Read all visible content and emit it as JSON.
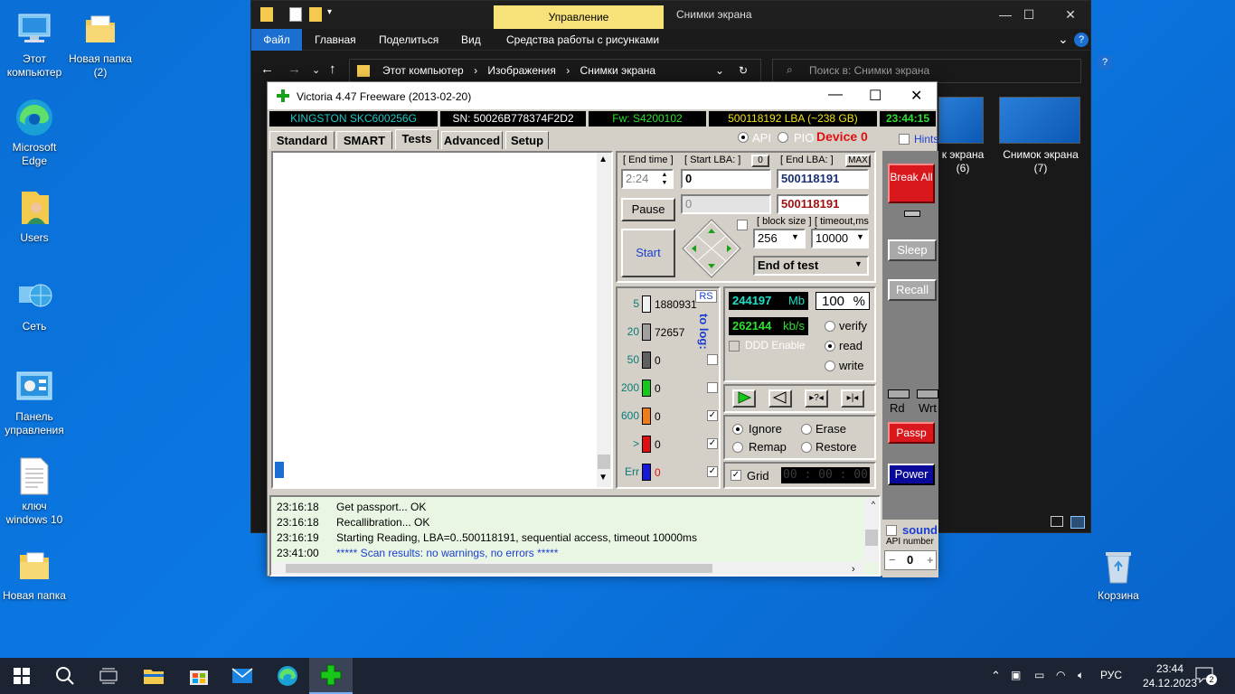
{
  "desktop": {
    "icons": [
      {
        "label": "Этот компьютер"
      },
      {
        "label": "Новая папка (2)"
      },
      {
        "label": "Microsoft Edge"
      },
      {
        "label": "Users"
      },
      {
        "label": "Сеть"
      },
      {
        "label": "Панель управления"
      },
      {
        "label": "ключ windows 10"
      },
      {
        "label": "Новая папка"
      },
      {
        "label": "Корзина"
      }
    ]
  },
  "explorer": {
    "context_tab": "Управление",
    "window_title": "Снимки экрана",
    "ribbon": {
      "file": "Файл",
      "home": "Главная",
      "share": "Поделиться",
      "view": "Вид",
      "picture_tools": "Средства работы с рисунками"
    },
    "breadcrumb": [
      "Этот компьютер",
      "Изображения",
      "Снимки экрана"
    ],
    "search_placeholder": "Поиск в: Снимки экрана",
    "thumbs": [
      {
        "label_line1": "к экрана",
        "label_line2": "(6)"
      },
      {
        "label_line1": "Снимок экрана",
        "label_line2": "(7)"
      }
    ]
  },
  "victoria": {
    "title": "Victoria 4.47  Freeware (2013-02-20)",
    "info": {
      "model": "KINGSTON SKC600256G",
      "serial": "SN: 50026B778374F2D2",
      "firmware": "Fw: S4200102",
      "capacity": "500118192 LBA (~238 GB)",
      "clock": "23:44:15"
    },
    "tabs": [
      "Standard",
      "SMART",
      "Tests",
      "Advanced",
      "Setup"
    ],
    "mode": {
      "api": "API",
      "pio": "PIO",
      "device": "Device 0",
      "hints": "Hints"
    },
    "test": {
      "end_time_label": "[ End time ]",
      "end_time": "2:24",
      "start_lba_label": "[ Start LBA: ]",
      "start_lba_zero_btn": "0",
      "start_lba": "0",
      "end_lba_label": "[ End LBA: ]",
      "end_lba_max_btn": "MAX",
      "end_lba": "500118191",
      "current_lba": "0",
      "current_end_lba": "500118191",
      "pause": "Pause",
      "start": "Start",
      "block_size_label": "[ block size ]",
      "block_size": "256",
      "timeout_label": "[ timeout,ms ]",
      "timeout": "10000",
      "end_action": "End of test"
    },
    "blocks": {
      "rs": "RS",
      "to_log": "to log:",
      "rows": [
        {
          "label": "5",
          "count": "1880931",
          "color": "#f0f0f0",
          "logged": false
        },
        {
          "label": "20",
          "count": "72657",
          "color": "#a0a0a0",
          "logged": false
        },
        {
          "label": "50",
          "count": "0",
          "color": "#606060",
          "logged": false
        },
        {
          "label": "200",
          "count": "0",
          "color": "#18c818",
          "logged": false
        },
        {
          "label": "600",
          "count": "0",
          "color": "#f07c18",
          "logged": true
        },
        {
          "label": ">",
          "count": "0",
          "color": "#e01010",
          "logged": true
        },
        {
          "label": "Err",
          "count": "0",
          "color": "#1818d8",
          "logged": true
        }
      ]
    },
    "stats": {
      "mb": "244197",
      "mb_unit": "Mb",
      "percent": "100",
      "percent_unit": "%",
      "speed": "262144",
      "speed_unit": "kb/s",
      "ddd": "DDD Enable",
      "verify": "verify",
      "read": "read",
      "write": "write",
      "ignore": "Ignore",
      "erase": "Erase",
      "remap": "Remap",
      "restore": "Restore",
      "grid": "Grid",
      "timer": "00 : 00 : 00"
    },
    "side": {
      "break_all": "Break All",
      "sleep": "Sleep",
      "recall": "Recall",
      "rd": "Rd",
      "wrt": "Wrt",
      "passp": "Passp",
      "power": "Power",
      "sound": "sound",
      "api_number": "API number",
      "api_value": "0"
    },
    "log": [
      {
        "time": "23:16:18",
        "text": "Get passport... OK",
        "color": "#000000"
      },
      {
        "time": "23:16:18",
        "text": "Recallibration... OK",
        "color": "#000000"
      },
      {
        "time": "23:16:19",
        "text": "Starting Reading, LBA=0..500118191, sequential access, timeout 10000ms",
        "color": "#000000"
      },
      {
        "time": "23:41:00",
        "text": "***** Scan results: no warnings, no errors *****",
        "color": "#1a3fd0"
      }
    ]
  },
  "taskbar": {
    "language": "РУС",
    "time": "23:44",
    "date": "24.12.2023",
    "notifications": "2"
  }
}
